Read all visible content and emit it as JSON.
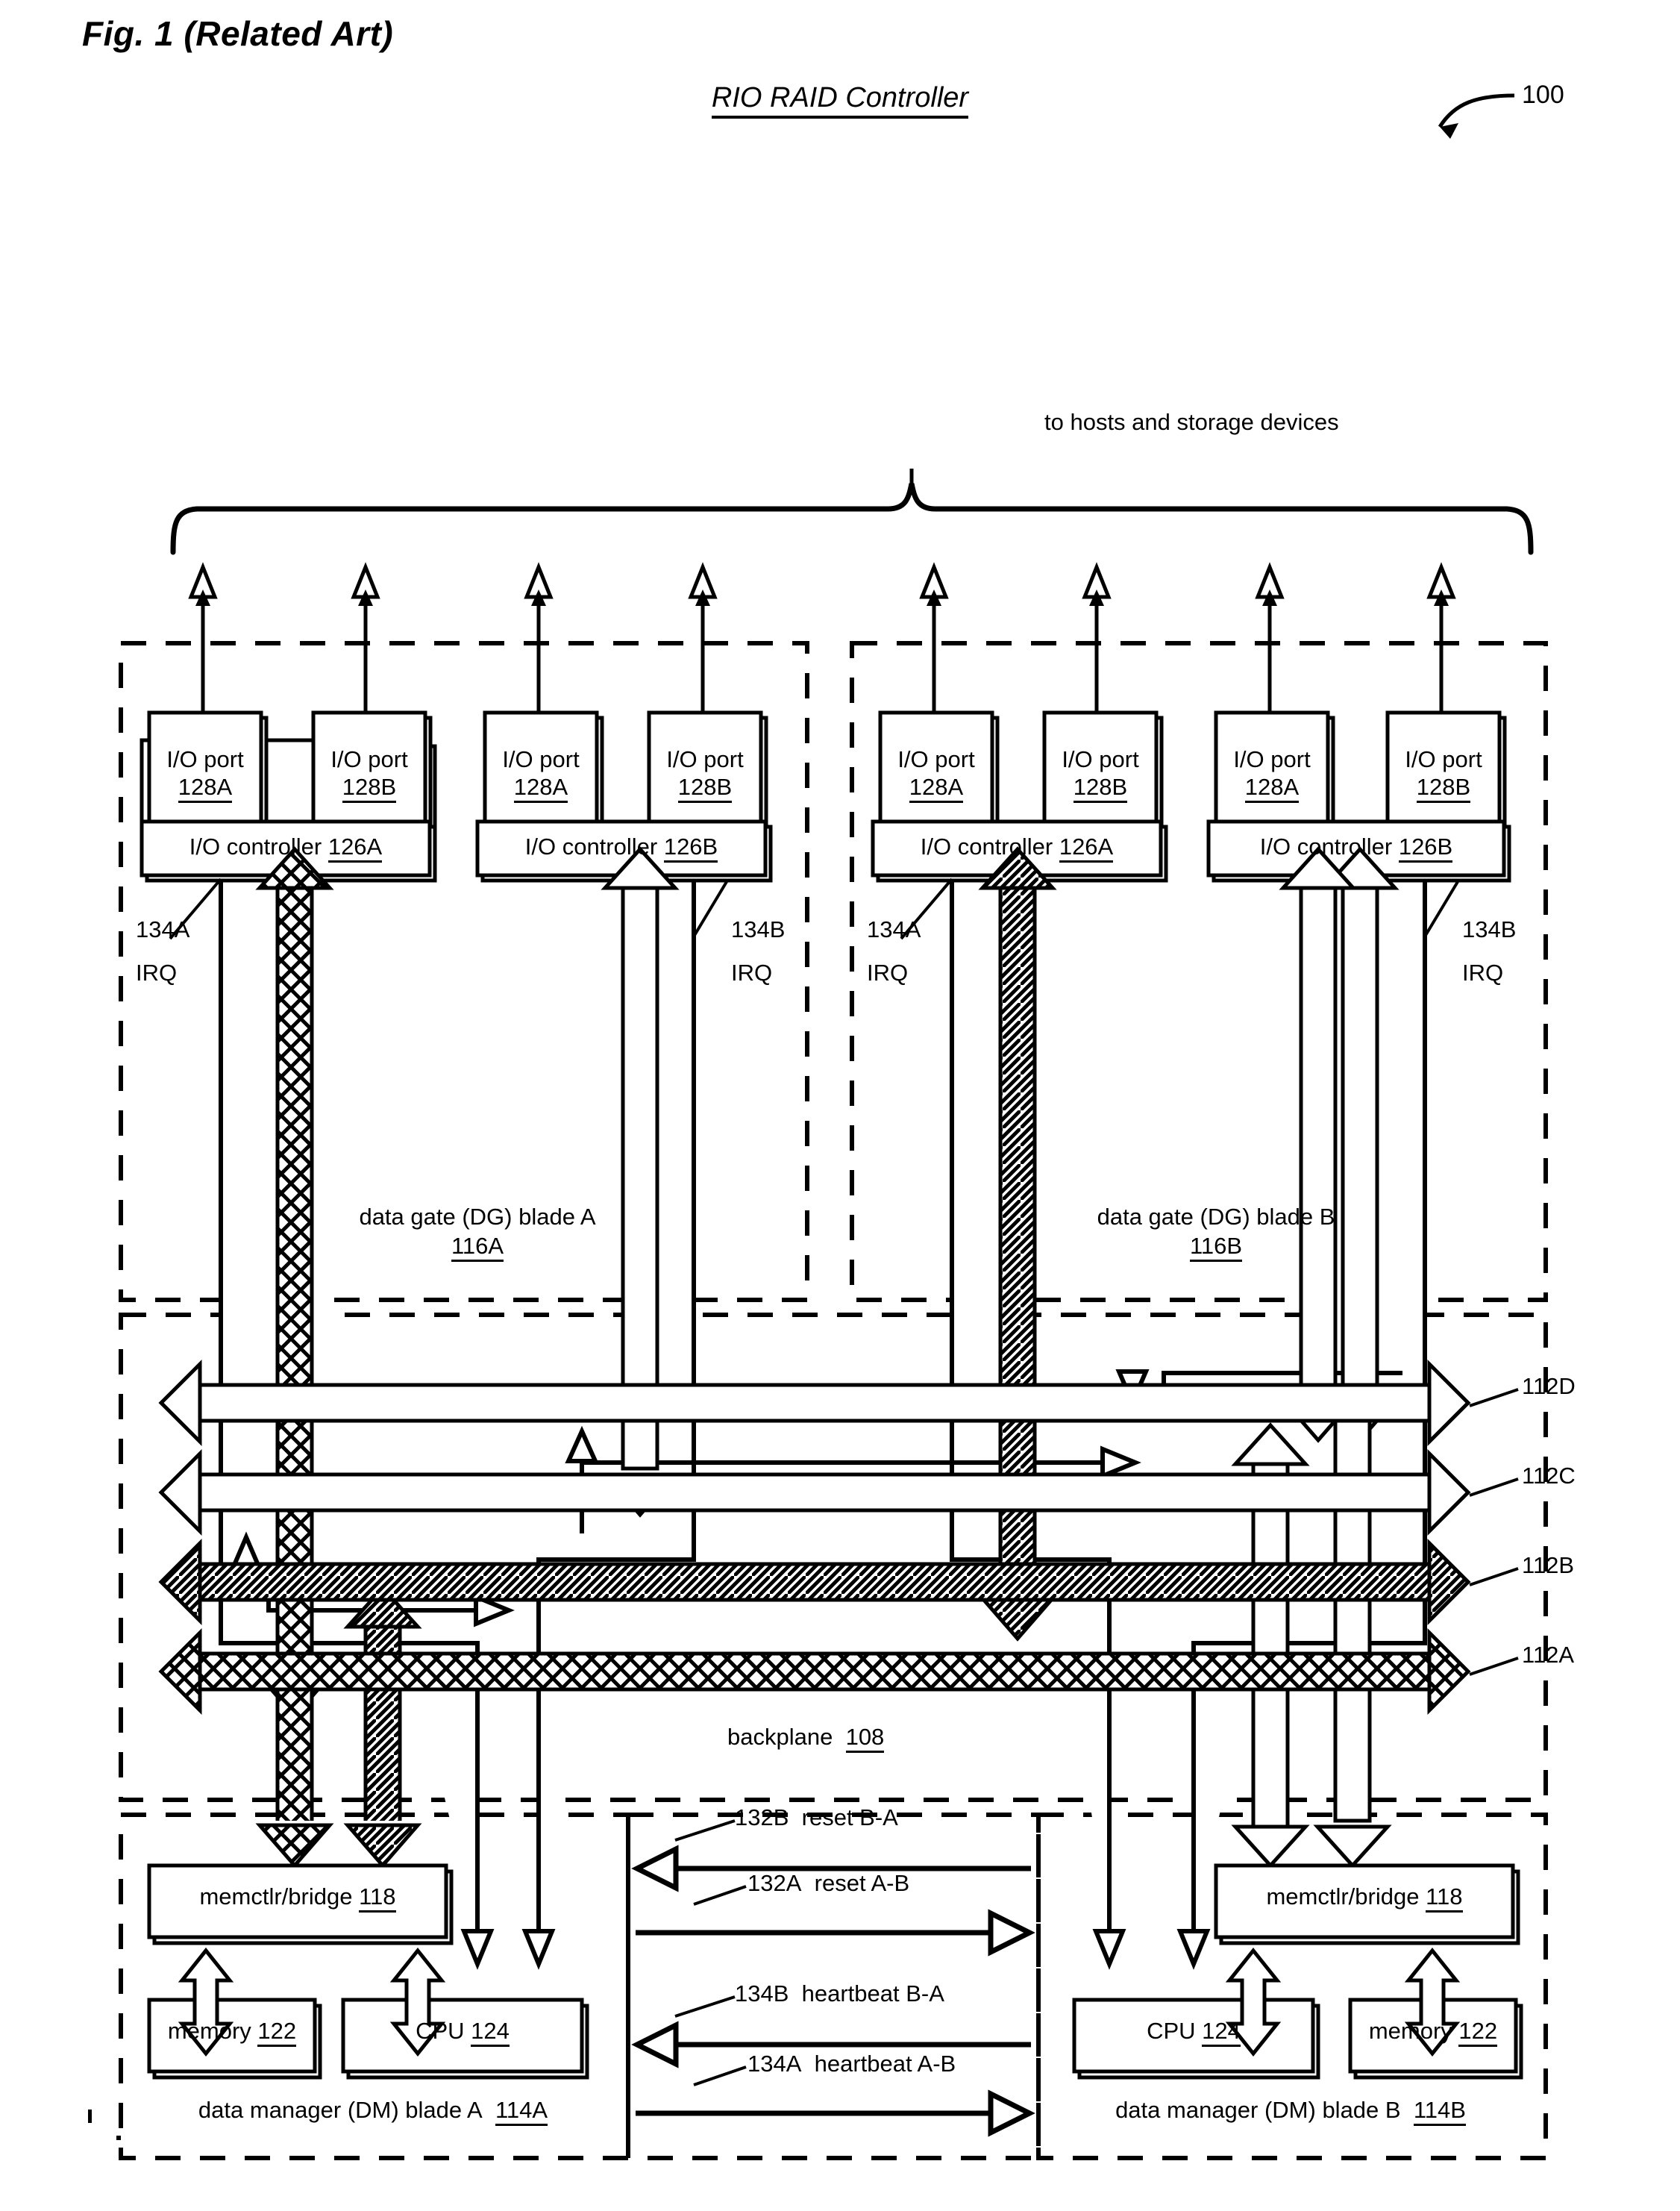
{
  "figure": {
    "figure_label": "Fig. 1 (Related Art)",
    "title": "RIO RAID Controller",
    "ref_numeral": "100",
    "top_caption": "to hosts and storage devices",
    "backplane_label": "backplane",
    "backplane_ref": "108"
  },
  "buses": [
    {
      "id": "112D",
      "label": "112D",
      "fill": "hollow"
    },
    {
      "id": "112C",
      "label": "112C",
      "fill": "hollow"
    },
    {
      "id": "112B",
      "label": "112B",
      "fill": "diagonal-hatch"
    },
    {
      "id": "112A",
      "label": "112A",
      "fill": "cross-hatch"
    }
  ],
  "dg_blades": [
    {
      "name": "data gate (DG) blade A",
      "ref": "116A",
      "io_controllers": [
        {
          "label": "I/O controller",
          "ref": "126A",
          "ports": [
            {
              "label": "I/O port",
              "ref": "128A"
            },
            {
              "label": "I/O port",
              "ref": "128B"
            }
          ],
          "irq_ref": "134A",
          "irq_label": "IRQ"
        },
        {
          "label": "I/O controller",
          "ref": "126B",
          "ports": [
            {
              "label": "I/O port",
              "ref": "128A"
            },
            {
              "label": "I/O port",
              "ref": "128B"
            }
          ],
          "irq_ref": "134B",
          "irq_label": "IRQ"
        }
      ]
    },
    {
      "name": "data gate (DG) blade B",
      "ref": "116B",
      "io_controllers": [
        {
          "label": "I/O controller",
          "ref": "126A",
          "ports": [
            {
              "label": "I/O port",
              "ref": "128A"
            },
            {
              "label": "I/O port",
              "ref": "128B"
            }
          ],
          "irq_ref": "134A",
          "irq_label": "IRQ"
        },
        {
          "label": "I/O controller",
          "ref": "126B",
          "ports": [
            {
              "label": "I/O port",
              "ref": "128A"
            },
            {
              "label": "I/O port",
              "ref": "128B"
            }
          ],
          "irq_ref": "134B",
          "irq_label": "IRQ"
        }
      ]
    }
  ],
  "dm_blades": [
    {
      "name": "data manager (DM) blade A",
      "ref": "114A",
      "bridge": {
        "label": "memctlr/bridge",
        "ref": "118"
      },
      "memory": {
        "label": "memory",
        "ref": "122"
      },
      "cpu": {
        "label": "CPU",
        "ref": "124"
      }
    },
    {
      "name": "data manager (DM) blade B",
      "ref": "114B",
      "bridge": {
        "label": "memctlr/bridge",
        "ref": "118"
      },
      "memory": {
        "label": "memory",
        "ref": "122"
      },
      "cpu": {
        "label": "CPU",
        "ref": "124"
      }
    }
  ],
  "interblade_signals": [
    {
      "ref": "132B",
      "label": "reset B-A",
      "direction": "right-to-left"
    },
    {
      "ref": "132A",
      "label": "reset A-B",
      "direction": "left-to-right"
    },
    {
      "ref": "134B",
      "label": "heartbeat B-A",
      "direction": "right-to-left"
    },
    {
      "ref": "134A",
      "label": "heartbeat A-B",
      "direction": "left-to-right"
    }
  ]
}
